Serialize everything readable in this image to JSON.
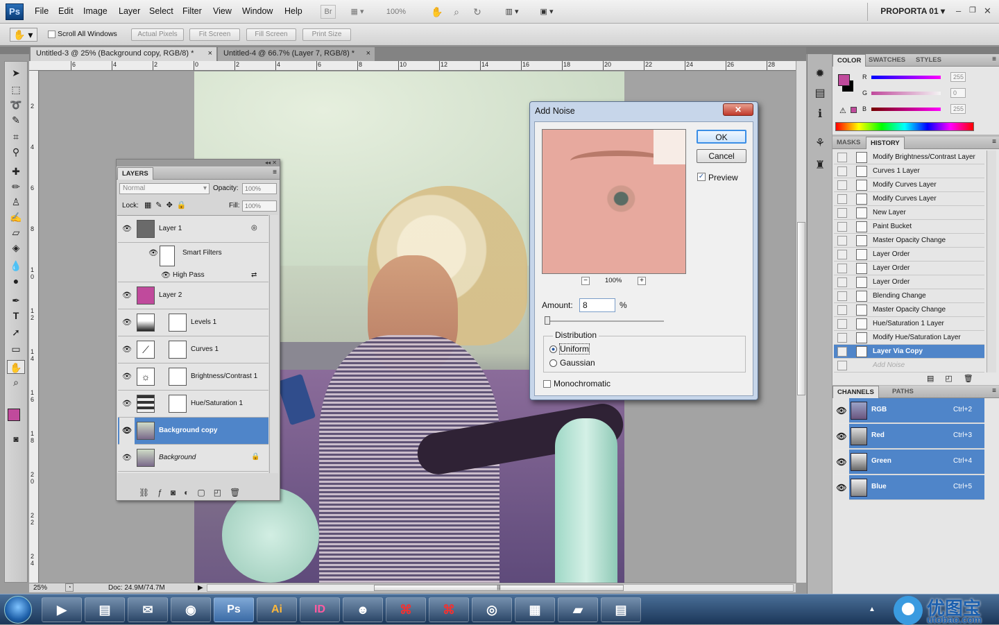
{
  "menubar": {
    "logo": "Ps",
    "items": [
      "File",
      "Edit",
      "Image",
      "Layer",
      "Select",
      "Filter",
      "View",
      "Window",
      "Help"
    ],
    "bridge": "Br",
    "zoom": "100%",
    "workspace": "PROPORTA 01",
    "win_controls": [
      "–",
      "❐",
      "✕"
    ]
  },
  "options": {
    "scroll_all": "Scroll All Windows",
    "buttons": [
      "Actual Pixels",
      "Fit Screen",
      "Fill Screen",
      "Print Size"
    ]
  },
  "tabs": [
    {
      "label": "Untitled-3 @ 25% (Background copy, RGB/8) *",
      "close": "×"
    },
    {
      "label": "Untitled-4 @ 66.7% (Layer 7, RGB/8) *",
      "close": "×"
    }
  ],
  "ruler": {
    "h": [
      "6",
      "4",
      "2",
      "0",
      "2",
      "4",
      "6",
      "8",
      "10",
      "12",
      "14",
      "16",
      "18",
      "20",
      "22",
      "24",
      "26",
      "28"
    ],
    "v": [
      "2",
      "4",
      "6",
      "8",
      "1 0",
      "1 2",
      "1 4",
      "1 6",
      "1 8",
      "2 0",
      "2 2",
      "2 4"
    ]
  },
  "status": {
    "zoom": "25%",
    "doc": "Doc: 24.9M/74.7M"
  },
  "layers": {
    "tab": "LAYERS",
    "blend": "Normal",
    "opacity_label": "Opacity:",
    "opacity": "100%",
    "lock_label": "Lock:",
    "fill_label": "Fill:",
    "fill": "100%",
    "rows": [
      {
        "name": "Layer 1"
      },
      {
        "name": "Smart Filters"
      },
      {
        "name": "High Pass"
      },
      {
        "name": "Layer 2"
      },
      {
        "name": "Levels 1"
      },
      {
        "name": "Curves 1"
      },
      {
        "name": "Brightness/Contrast 1"
      },
      {
        "name": "Hue/Saturation 1"
      },
      {
        "name": "Background copy"
      },
      {
        "name": "Background"
      }
    ]
  },
  "dialog": {
    "title": "Add Noise",
    "ok": "OK",
    "cancel": "Cancel",
    "preview": "Preview",
    "zoom": "100%",
    "amount_label": "Amount:",
    "amount": "8",
    "pct": "%",
    "distribution": "Distribution",
    "uniform": "Uniform",
    "gaussian": "Gaussian",
    "mono": "Monochromatic"
  },
  "color_panel": {
    "tabs": [
      "COLOR",
      "SWATCHES",
      "STYLES"
    ],
    "r_label": "R",
    "g_label": "G",
    "b_label": "B",
    "r": "255",
    "g": "0",
    "b": "255"
  },
  "history": {
    "tabs": [
      "MASKS",
      "HISTORY"
    ],
    "items": [
      "Modify Brightness/Contrast Layer",
      "Curves 1 Layer",
      "Modify Curves Layer",
      "Modify Curves Layer",
      "New Layer",
      "Paint Bucket",
      "Master Opacity Change",
      "Layer Order",
      "Layer Order",
      "Layer Order",
      "Blending Change",
      "Master Opacity Change",
      "Hue/Saturation 1 Layer",
      "Modify Hue/Saturation Layer",
      "Layer Via Copy",
      "Add Noise"
    ]
  },
  "channels": {
    "tabs": [
      "CHANNELS",
      "PATHS"
    ],
    "rows": [
      {
        "name": "RGB",
        "shortcut": "Ctrl+2"
      },
      {
        "name": "Red",
        "shortcut": "Ctrl+3"
      },
      {
        "name": "Green",
        "shortcut": "Ctrl+4"
      },
      {
        "name": "Blue",
        "shortcut": "Ctrl+5"
      }
    ]
  },
  "taskbar": {
    "apps": [
      "Ps",
      "Ai",
      "ID"
    ],
    "watermark": "优图宝",
    "watermark_url": "utobao.com"
  },
  "colors": {
    "foreground": "#c04a9c",
    "selection": "#4f85c9"
  }
}
